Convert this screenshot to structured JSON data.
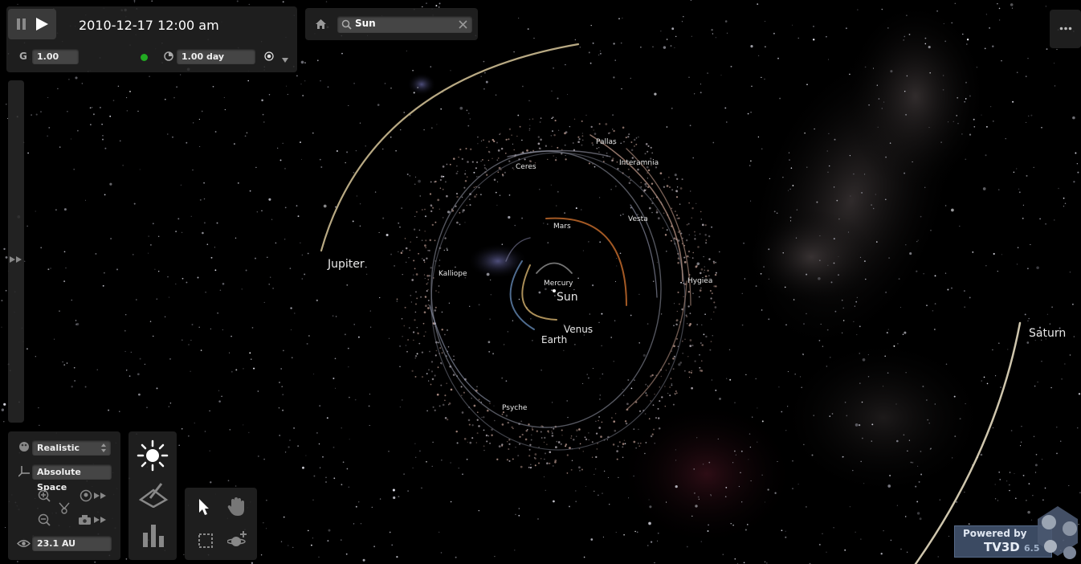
{
  "header": {
    "datetime": "2010-12-17 12:00 am",
    "gravity_label": "G",
    "gravity_value": "1.00",
    "step_value": "1.00 day"
  },
  "search": {
    "value": "Sun"
  },
  "view": {
    "render_mode": "Realistic",
    "reference_frame": "Absolute Space",
    "distance": "23.1 AU"
  },
  "bodies": {
    "sun": "Sun",
    "mercury": "Mercury",
    "venus": "Venus",
    "earth": "Earth",
    "mars": "Mars",
    "jupiter": "Jupiter",
    "saturn": "Saturn",
    "ceres": "Ceres",
    "pallas": "Pallas",
    "interamnia": "Interamnia",
    "vesta": "Vesta",
    "hygiea": "Hygiea",
    "kalliope": "Kalliope",
    "psyche": "Psyche"
  },
  "branding": {
    "powered_by": "Powered by",
    "product": "TV3D",
    "version": "6.5"
  },
  "colors": {
    "jupiter_orbit": "#d8c79a",
    "mars_orbit": "#c0682a",
    "earth_orbit": "#5d7fa8",
    "venus_orbit": "#c9a868",
    "asteroid_orbit": "#8a8a9a",
    "status_dot": "#22aa22"
  }
}
